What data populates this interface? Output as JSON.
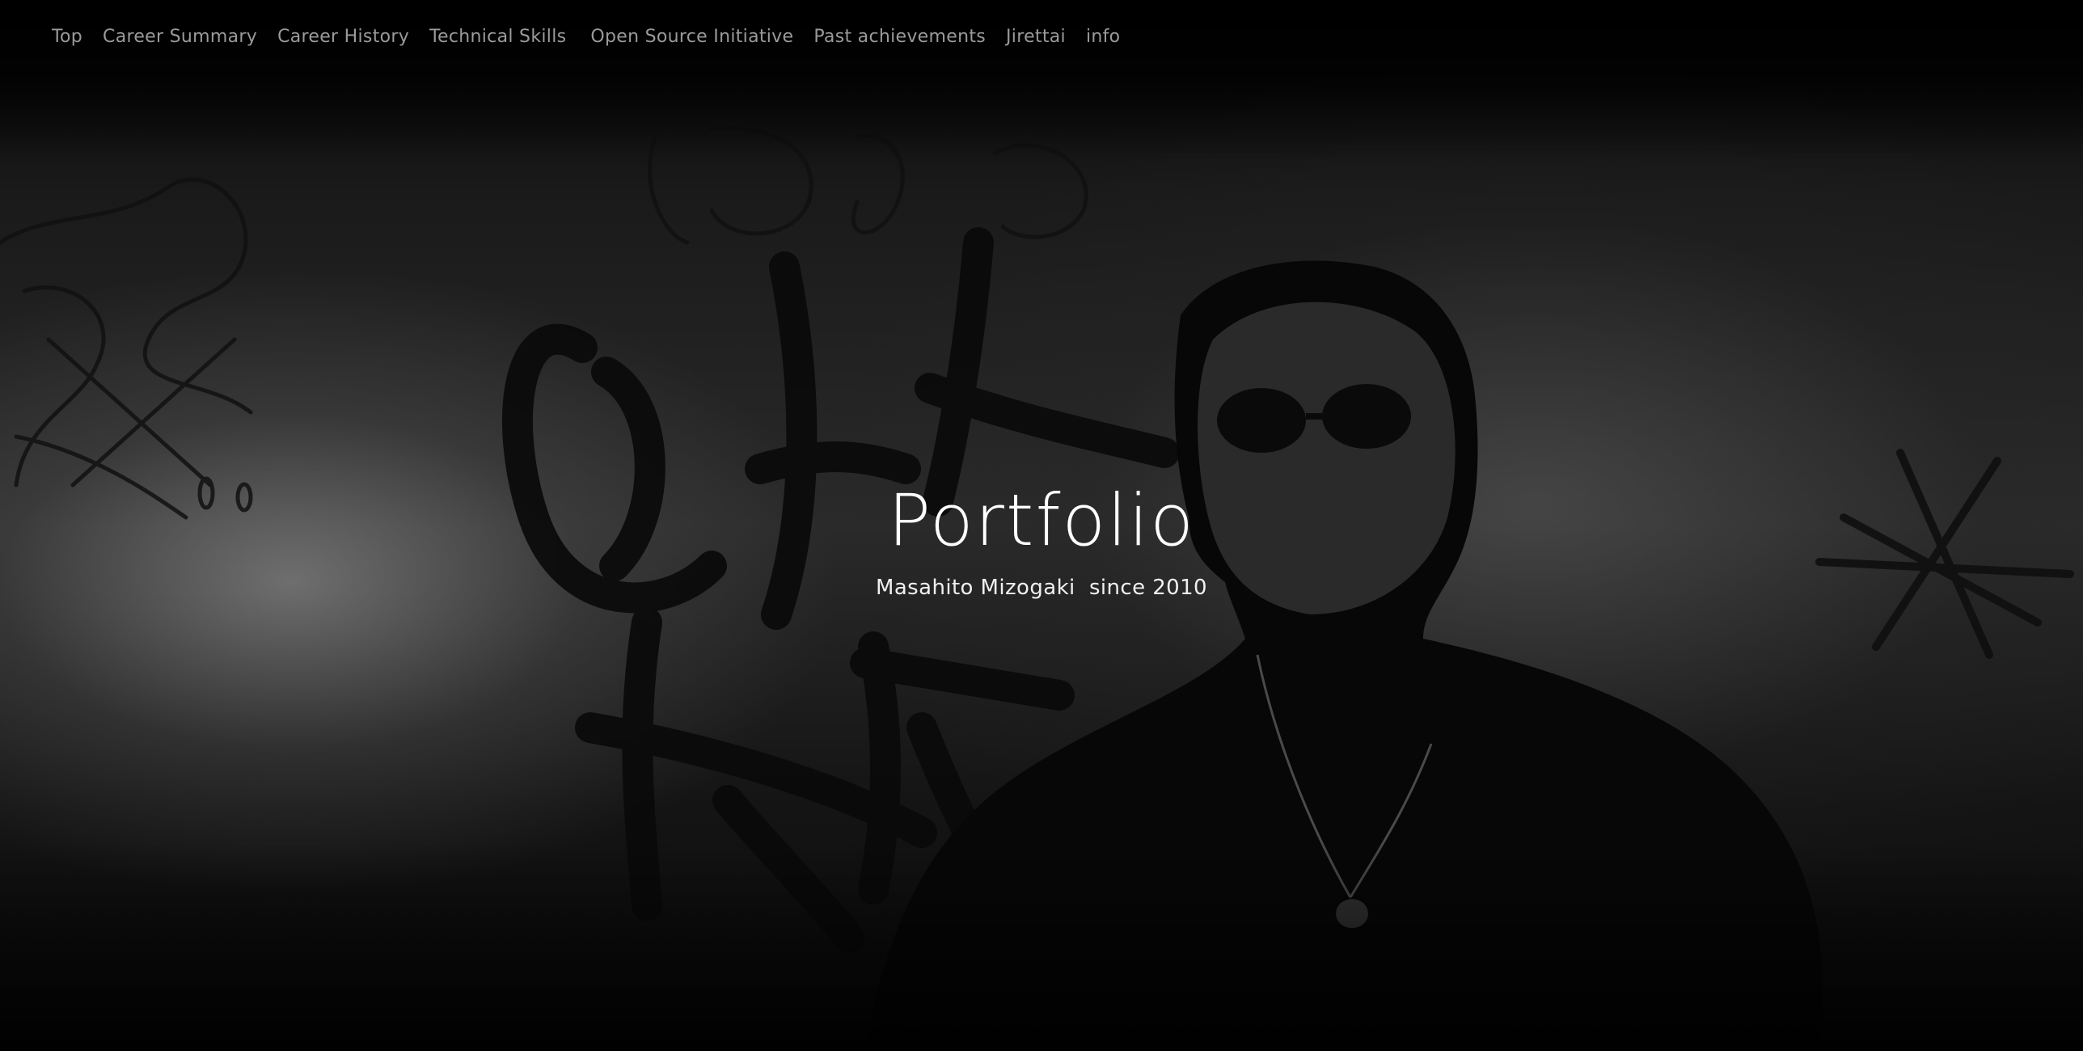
{
  "nav": {
    "items": [
      {
        "label": "Top"
      },
      {
        "label": "Career Summary"
      },
      {
        "label": "Career History"
      },
      {
        "label": "Technical Skills"
      },
      {
        "label": "Open Source Initiative"
      },
      {
        "label": "Past achievements"
      },
      {
        "label": "Jirettai"
      },
      {
        "label": "info"
      }
    ]
  },
  "hero": {
    "title": "Portfolio",
    "subtitle": "Masahito Mizogaki  since 2010",
    "background_description_icon": "graffiti-portrait-photo"
  },
  "colors": {
    "background": "#000000",
    "nav_text": "#9a9a9a",
    "title_text": "#ffffff"
  }
}
